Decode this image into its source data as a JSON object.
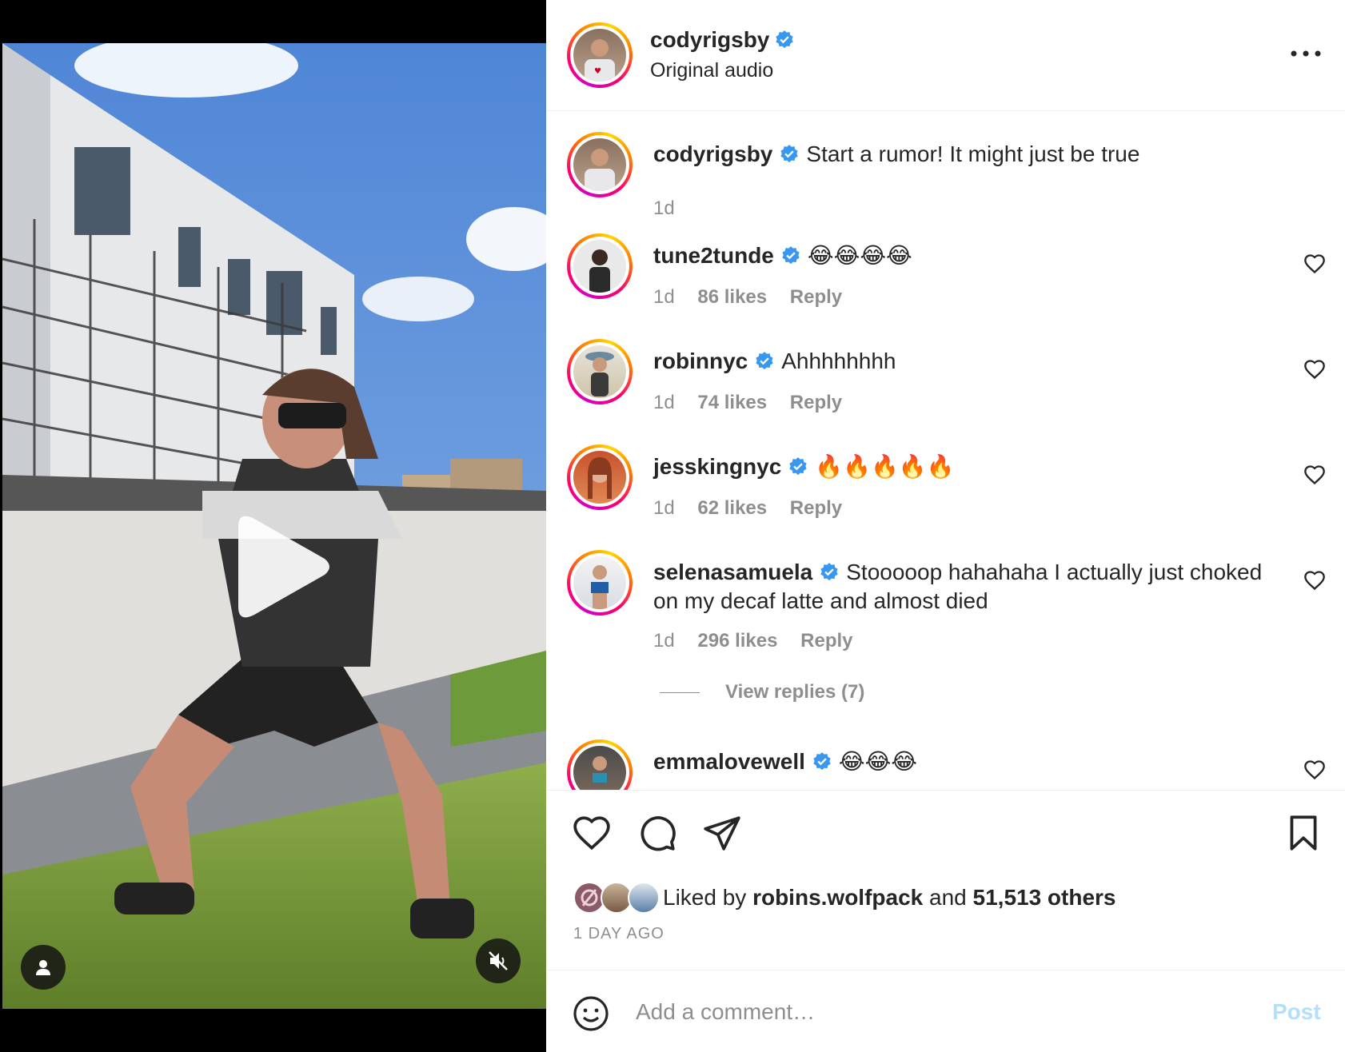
{
  "post": {
    "author": "codyrigsby",
    "audio_label": "Original audio",
    "caption": "Start a rumor! It might just be true",
    "caption_time": "1d"
  },
  "comments": [
    {
      "user": "tune2tunde",
      "text": "😂😂😂😂",
      "time": "1d",
      "likes": "86 likes",
      "reply": "Reply"
    },
    {
      "user": "robinnyc",
      "text": "Ahhhhhhhh",
      "time": "1d",
      "likes": "74 likes",
      "reply": "Reply"
    },
    {
      "user": "jesskingnyc",
      "text": "🔥🔥🔥🔥🔥",
      "time": "1d",
      "likes": "62 likes",
      "reply": "Reply"
    },
    {
      "user": "selenasamuela",
      "text": "Stooooop hahahaha I actually just choked on my decaf latte and almost died",
      "time": "1d",
      "likes": "296 likes",
      "reply": "Reply"
    },
    {
      "user": "emmalovewell",
      "text": "😂😂😂"
    }
  ],
  "view_replies": "View replies (7)",
  "liked_by": {
    "prefix": "Liked by",
    "user": "robins.wolfpack",
    "and": "and",
    "others": "51,513 others"
  },
  "date_label": "1 DAY AGO",
  "comment_box": {
    "placeholder": "Add a comment…",
    "post_label": "Post"
  },
  "icons": {
    "verified": "verified-badge-icon",
    "more": "more-options-icon",
    "like": "heart-icon",
    "comment": "comment-bubble-icon",
    "share": "send-icon",
    "save": "bookmark-icon",
    "emoji": "emoji-icon",
    "play": "play-icon",
    "user": "user-icon",
    "mute": "muted-speaker-icon"
  },
  "colors": {
    "verified": "#3897f0",
    "post_button": "#b2dffc",
    "muted_text": "#8e8e8e",
    "text": "#262626"
  }
}
